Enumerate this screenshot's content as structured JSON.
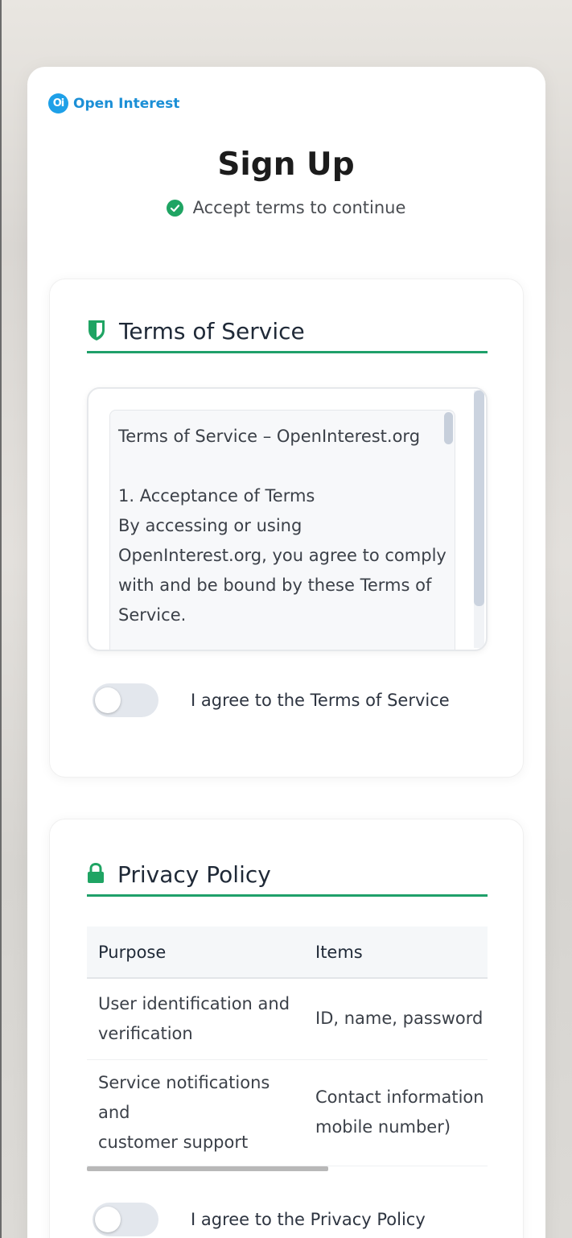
{
  "brand": {
    "logo_text": "Oi",
    "name": "Open Interest"
  },
  "page": {
    "title": "Sign Up",
    "subtitle": "Accept terms to continue"
  },
  "terms": {
    "title": "Terms of Service",
    "content": [
      "Terms of Service – OpenInterest.org",
      "",
      "1.  Acceptance of Terms",
      "By accessing or using",
      "OpenInterest.org, you agree to comply",
      "with and be bound by these Terms of",
      "Service."
    ],
    "agree_label": "I agree to the Terms of Service",
    "agree_checked": false
  },
  "privacy": {
    "title": "Privacy Policy",
    "columns": [
      "Purpose",
      "Items"
    ],
    "rows": [
      {
        "purpose": [
          "User identification and",
          "verification"
        ],
        "items": [
          "ID, name, password"
        ]
      },
      {
        "purpose": [
          "Service notifications",
          "and",
          "customer support"
        ],
        "items": [
          "Contact information (",
          "mobile number)"
        ]
      }
    ],
    "agree_label": "I agree to the Privacy Policy",
    "agree_checked": false
  },
  "colors": {
    "accent_green": "#1fa06a",
    "brand_blue": "#1b8fd6"
  }
}
